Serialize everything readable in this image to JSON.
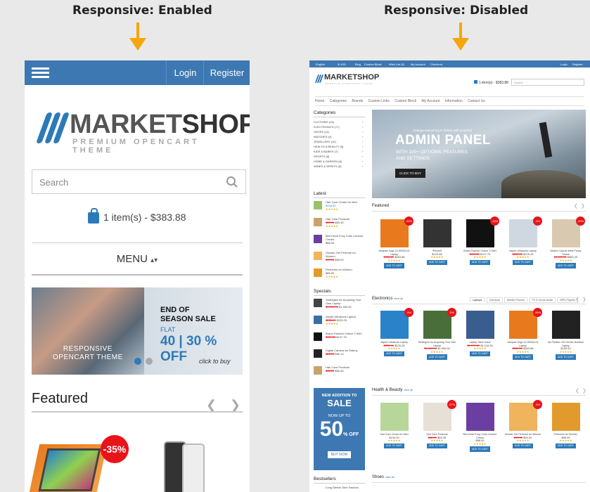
{
  "captions": {
    "left": "Responsive: Enabled",
    "right": "Responsive: Disabled"
  },
  "colors": {
    "brand_blue": "#3d78b2",
    "arrow": "#f5a60c",
    "sale_red": "#e8141b",
    "star": "#f3a305"
  },
  "mobile": {
    "login": "Login",
    "register": "Register",
    "logo_title": "MARKETSHOP",
    "logo_sub": "PREMIUM OPENCART THEME",
    "search_placeholder": "Search",
    "cart": "1 item(s) - $383.88",
    "menu": "MENU",
    "banner": {
      "title1": "END OF",
      "title2": "SEASON SALE",
      "flat": "FLAT",
      "offer": "40 | 30 % OFF",
      "resp1": "RESPONSIVE",
      "resp2": "OPENCART THEME",
      "click": "click to buy"
    },
    "featured": "Featured",
    "sale_badge": "-35%"
  },
  "desktop": {
    "topbar": [
      "English",
      "$ USD",
      "Blog",
      "Custom Block",
      "Wish List (0)",
      "My Account",
      "Checkout"
    ],
    "login": "Login",
    "register": "Register",
    "logo_title": "MARKETSHOP",
    "logo_sub": "PREMIUM OPENCART THEME",
    "cart": "1 item(s) - $383.88",
    "search_placeholder": "Search",
    "nav": [
      "Home",
      "Categories",
      "Brands",
      "Custom Links",
      "Custom Block",
      "My Account",
      "Information",
      "Contact Us"
    ],
    "categories_title": "Categories",
    "categories": [
      "CLOTHING (15)",
      "ELECTRONICS (17)",
      "SHOES (11)",
      "WATCHES (4)",
      "JEWELLERY (12)",
      "HEALTH & BEAUTY (8)",
      "KIDS & BABIES (7)",
      "SPORTS (8)",
      "HOME & GARDEN (6)",
      "WINES & SPIRITS (5)"
    ],
    "latest_title": "Latest",
    "latest": [
      {
        "name": "Hair Care Cream for Men",
        "price": "$134.00"
      },
      {
        "name": "Hair Care Products",
        "old": "$88.00",
        "price": "$65.45"
      },
      {
        "name": "Bed Head Foxy Curls Contour Cream",
        "price": "$88.00"
      },
      {
        "name": "Shower Gel Perfume for Women",
        "old": "$95.00",
        "price": "$95.00"
      },
      {
        "name": "Perfumes for Women",
        "price": "$85.00"
      }
    ],
    "specials_title": "Specials",
    "specials": [
      {
        "name": "Strategies for Acquiring Your Own Laptop",
        "old": "$1,900.00",
        "price": "$1,900.00"
      },
      {
        "name": "Aspire Ultrabook Laptop",
        "old": "$235.00",
        "price": "$225.25"
      },
      {
        "name": "Brand Fashion Cotton T-Shirt",
        "old": "$119.00",
        "price": "$107.75"
      },
      {
        "name": "Digital Camera for Elderly",
        "old": "$86.00",
        "price": "$90.13"
      },
      {
        "name": "Hair Care Products",
        "old": "$88.00",
        "price": "$65.45"
      }
    ],
    "salebox": {
      "l1": "NEW ADDITION TO",
      "l2": "SALE",
      "l3": "NOW UP TO",
      "l4": "50",
      "l5": "% OFF",
      "btn": "BUY NOW"
    },
    "bestsellers_title": "Bestsellers",
    "bestsellers_first": "Long Sleeve Shirt Fashion",
    "hero": {
      "small": "Change everything in theme with powerful",
      "title": "ADMIN PANEL",
      "l1": "WITH 100+ OPTIONS, FEATURES",
      "l2": "AND SETTINGS",
      "btn": "CLICK TO BUY"
    },
    "featured_title": "Featured",
    "featured": [
      {
        "name": "Ideapad Yoga 13-59341124 Laptop",
        "old": "$588.50",
        "price": "$383.88",
        "badge": "-35%"
      },
      {
        "name": "iPhone5",
        "price": "$120.68"
      },
      {
        "name": "Brand Fashion Cotton T-Shirt",
        "old": "$119.00",
        "price": "$107.75",
        "badge": "-10%"
      },
      {
        "name": "Aspire Ultrabook Laptop",
        "old": "$235.00",
        "price": "$225.25",
        "badge": "-5%"
      },
      {
        "name": "Warfun Casual Wear Fancy Shoes",
        "old": "$1,172.00",
        "price": "$883.25",
        "badge": "-25%"
      }
    ],
    "electronics_title": "Electronics",
    "view_all": "view all",
    "electronics_tabs": [
      "Laptops",
      "Cameras",
      "Mobile Phones",
      "TV & Home Audio",
      "MP3 Players"
    ],
    "electronics": [
      {
        "name": "Aspire Ultrabook Laptop",
        "old": "$235.00",
        "price": "$225.25",
        "badge": "-5%"
      },
      {
        "name": "Strategies for Acquiring Your Own Laptop",
        "old": "$2,000.00",
        "price": "$1,900.00",
        "badge": "-5%"
      },
      {
        "name": "Laptop Silver black",
        "old": "$1,177.00",
        "price": "$1,118.25"
      },
      {
        "name": "Ideapad Yoga 13-59341124 Laptop",
        "old": "$588.50",
        "price": "$383.88",
        "badge": "-35%"
      },
      {
        "name": "Hp Pavilion G6 2314ax Notebok Laptop",
        "price": "$159.50"
      }
    ],
    "health_title": "Health & Beauty",
    "health": [
      {
        "name": "Hair Care Cream for Men",
        "price": "$134.00"
      },
      {
        "name": "Hair Care Products",
        "old": "$88.00",
        "price": "$65.45",
        "badge": "-27%"
      },
      {
        "name": "Bed Head Foxy Curls Contour Cream",
        "price": "$88.00"
      },
      {
        "name": "Shower Gel Perfume for Women",
        "old": "$95.00",
        "price": "$95.00",
        "badge": "-4%"
      },
      {
        "name": "Perfumes for Women",
        "price": "$85.00"
      }
    ],
    "shoes_title": "Shoes",
    "add_to_cart": "ADD TO CART"
  }
}
